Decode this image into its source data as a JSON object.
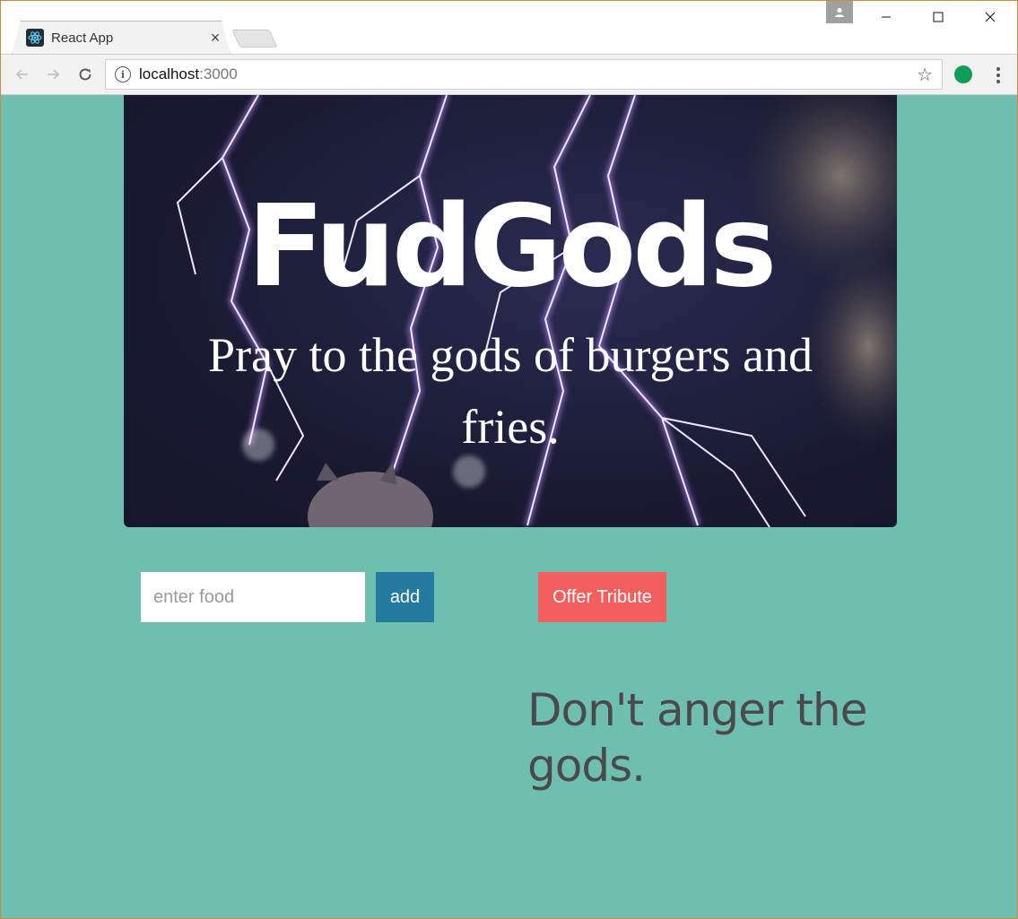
{
  "browser": {
    "tab_title": "React App",
    "tab_close": "×",
    "url_host": "localhost",
    "url_port": ":3000",
    "window_controls": {
      "minimize": "—",
      "maximize": "☐",
      "close": "✕"
    },
    "icons": [
      "react-favicon",
      "profile-icon",
      "back-arrow-icon",
      "forward-arrow-icon",
      "reload-icon",
      "info-icon",
      "star-icon",
      "hangouts-extension-icon",
      "menu-icon"
    ]
  },
  "hero": {
    "title": "FudGods",
    "subtitle": "Pray to the gods of burgers and fries.",
    "background_description_colors": {
      "sky": "#1a1b33",
      "lightning": "#c9a6ff"
    }
  },
  "form": {
    "food_placeholder": "enter food",
    "food_value": "",
    "add_label": "add",
    "tribute_label": "Offer Tribute"
  },
  "message": {
    "text": "Don't anger the gods."
  },
  "colors": {
    "page_bg": "#6fbfb1",
    "add_button": "#247ba0",
    "tribute_button": "#f25f5c",
    "message_text": "#4a4a4a"
  }
}
